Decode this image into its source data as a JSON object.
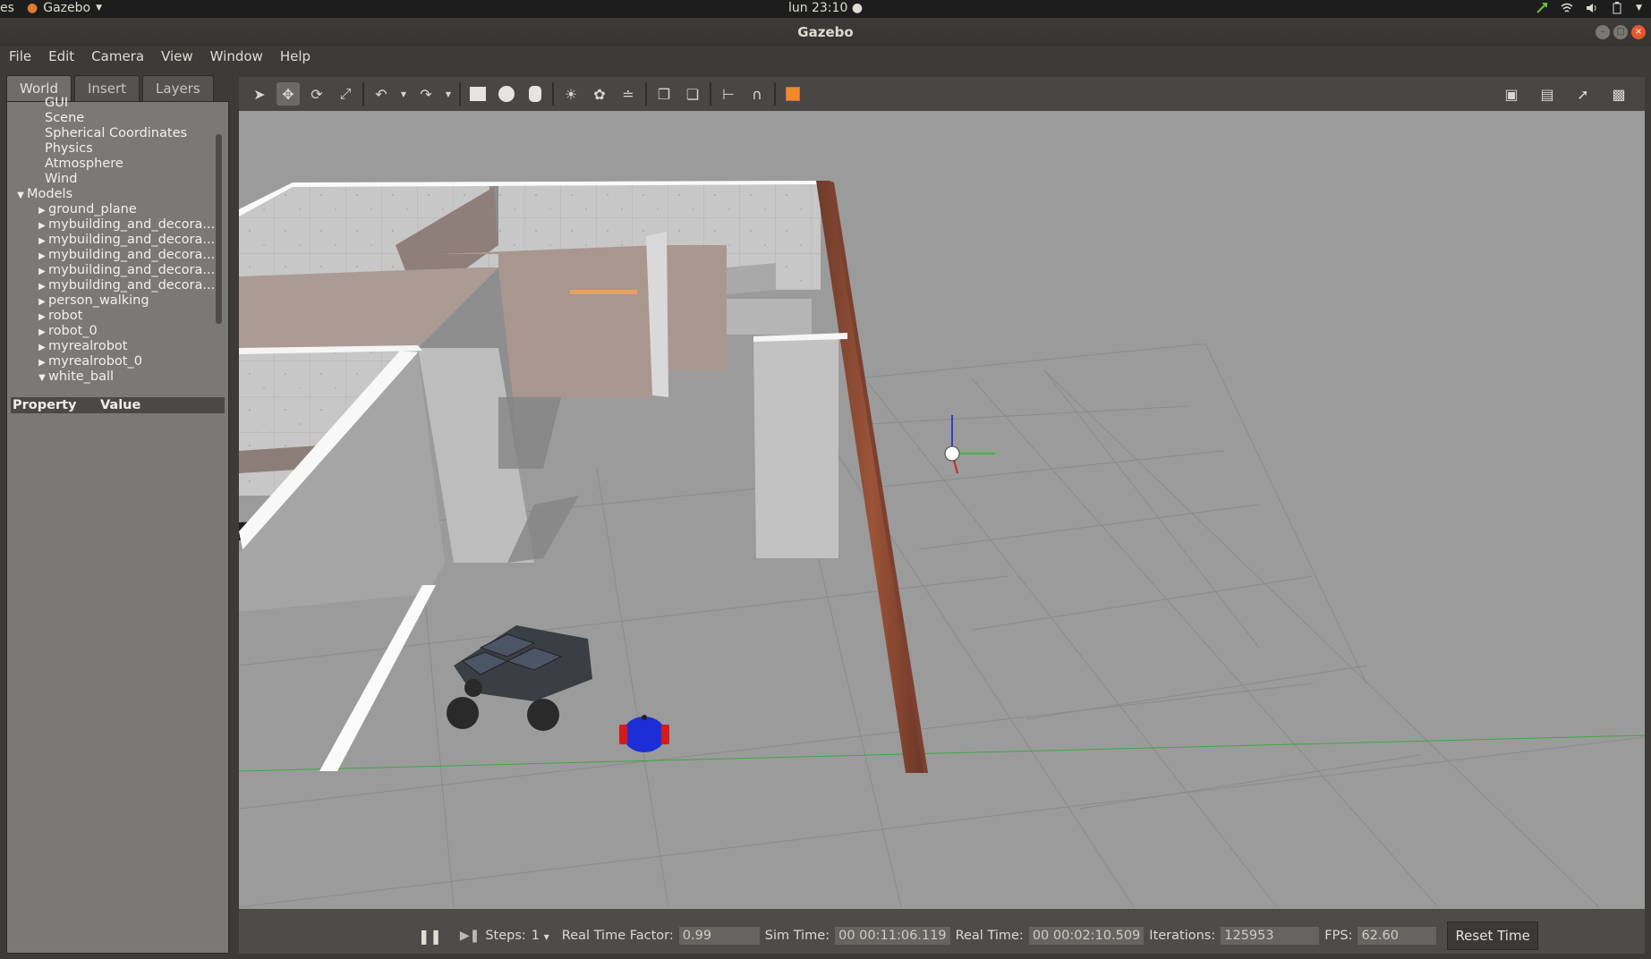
{
  "topbar": {
    "activities": "es",
    "app_name": "Gazebo",
    "clock": "lun 23:10 ●"
  },
  "window": {
    "title": "Gazebo"
  },
  "menu": {
    "file": "File",
    "edit": "Edit",
    "camera": "Camera",
    "view": "View",
    "window": "Window",
    "help": "Help"
  },
  "panel": {
    "tabs": [
      "World",
      "Insert",
      "Layers"
    ],
    "tree": {
      "items": [
        {
          "label": "GUI",
          "level": 1,
          "arrow": ""
        },
        {
          "label": "Scene",
          "level": 1,
          "arrow": ""
        },
        {
          "label": "Spherical Coordinates",
          "level": 1,
          "arrow": ""
        },
        {
          "label": "Physics",
          "level": 1,
          "arrow": ""
        },
        {
          "label": "Atmosphere",
          "level": 1,
          "arrow": ""
        },
        {
          "label": "Wind",
          "level": 1,
          "arrow": ""
        },
        {
          "label": "Models",
          "level": 0,
          "arrow": "▼"
        },
        {
          "label": "ground_plane",
          "level": 2,
          "arrow": "▶"
        },
        {
          "label": "mybuilding_and_decora...",
          "level": 2,
          "arrow": "▶"
        },
        {
          "label": "mybuilding_and_decora...",
          "level": 2,
          "arrow": "▶"
        },
        {
          "label": "mybuilding_and_decora...",
          "level": 2,
          "arrow": "▶"
        },
        {
          "label": "mybuilding_and_decora...",
          "level": 2,
          "arrow": "▶"
        },
        {
          "label": "mybuilding_and_decora...",
          "level": 2,
          "arrow": "▶"
        },
        {
          "label": "person_walking",
          "level": 2,
          "arrow": "▶"
        },
        {
          "label": "robot",
          "level": 2,
          "arrow": "▶"
        },
        {
          "label": "robot_0",
          "level": 2,
          "arrow": "▶"
        },
        {
          "label": "myrealrobot",
          "level": 2,
          "arrow": "▶"
        },
        {
          "label": "myrealrobot_0",
          "level": 2,
          "arrow": "▶"
        },
        {
          "label": "white_ball",
          "level": 2,
          "arrow": "▼"
        }
      ]
    },
    "property_header": "Property",
    "value_header": "Value"
  },
  "status": {
    "steps_label": "Steps:",
    "steps_value": "1",
    "rtf_label": "Real Time Factor:",
    "rtf_value": "0.99",
    "sim_label": "Sim Time:",
    "sim_value": "00 00:11:06.119",
    "real_label": "Real Time:",
    "real_value": "00 00:02:10.509",
    "iter_label": "Iterations:",
    "iter_value": "125953",
    "fps_label": "FPS:",
    "fps_value": "62.60",
    "reset_label": "Reset Time"
  },
  "icons": {
    "toolbar": [
      "select-icon",
      "translate-icon",
      "rotate-icon",
      "scale-icon",
      "undo-icon",
      "redo-icon",
      "box-icon",
      "sphere-icon",
      "cylinder-icon",
      "point-light-icon",
      "spot-light-icon",
      "directional-light-icon",
      "copy-icon",
      "paste-icon",
      "align-icon",
      "snap-icon",
      "view-angle-icon"
    ],
    "toolbar_right": [
      "screenshot-icon",
      "log-icon",
      "plot-icon",
      "record-icon"
    ]
  }
}
